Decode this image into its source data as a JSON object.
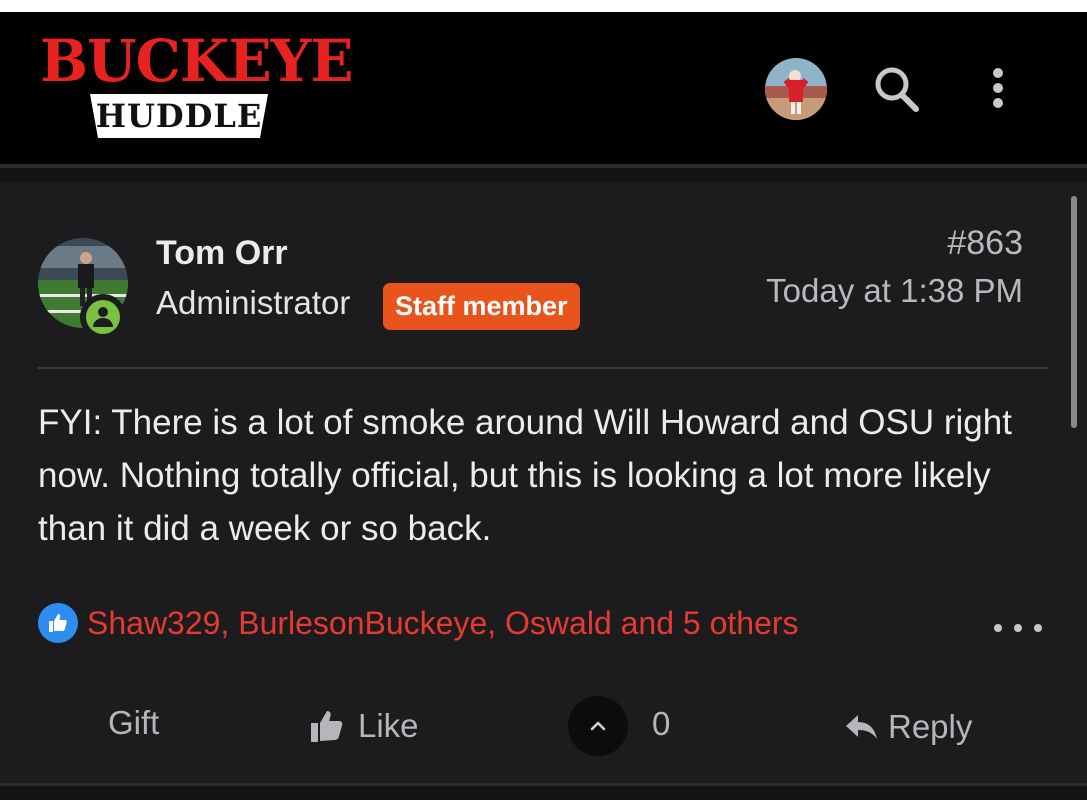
{
  "site": {
    "logo_top": "BUCKEYE",
    "logo_bottom": "HUDDLE"
  },
  "post": {
    "number": "#863",
    "time": "Today at 1:38 PM",
    "author": {
      "name": "Tom Orr",
      "role": "Administrator",
      "badge": "Staff member",
      "online": true
    },
    "body": "FYI: There is a lot of smoke around Will Howard and OSU right now. Nothing totally official, but this is looking a lot more likely than it did a week or so back.",
    "reactions_text": "Shaw329, BurlesonBuckeye, Oswald and 5 others",
    "actions": {
      "gift_label": "Gift",
      "like_label": "Like",
      "vote_count": "0",
      "reply_label": "Reply"
    }
  },
  "colors": {
    "brand_red": "#e8231f",
    "staff_badge": "#e8541c",
    "reaction_red": "#e63a30",
    "like_blue": "#2d8ef0",
    "online_green": "#7ac143",
    "background": "#1c1c1e",
    "header": "#000000"
  },
  "icons": [
    "avatar",
    "search-icon",
    "more-vertical-icon",
    "like-badge-icon",
    "more-horizontal-icon",
    "thumbs-up-icon",
    "chevron-up-icon",
    "reply-icon",
    "online-status-icon"
  ]
}
